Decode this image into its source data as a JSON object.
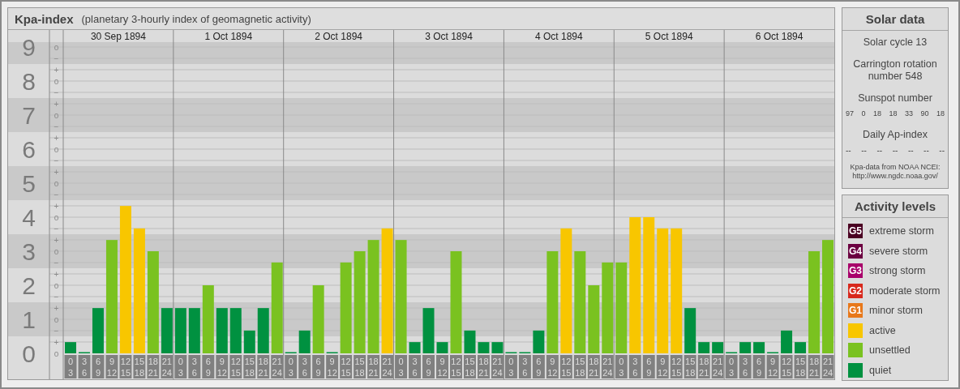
{
  "main_panel": {
    "title": "Kpa-index",
    "subtitle": "(planetary 3-hourly index of geomagnetic activity)"
  },
  "kp_chart": {
    "day_labels": [
      "30 Sep 1894",
      "1 Oct 1894",
      "2 Oct 1894",
      "3 Oct 1894",
      "4 Oct 1894",
      "5 Oct 1894",
      "6 Oct 1894"
    ],
    "sublevel_labels": [
      "o",
      "−",
      "+",
      "o",
      "−",
      "+",
      "o",
      "−",
      "+",
      "o",
      "−",
      "+",
      "o",
      "−",
      "+",
      "o",
      "−",
      "+",
      "o",
      "−",
      "+",
      "o",
      "−",
      "+",
      "o",
      "−",
      "+",
      "o"
    ],
    "chart_data": {
      "type": "bar",
      "grid": true,
      "ylim": [
        0,
        9.5
      ],
      "yticks": [
        {
          "value": 0,
          "label": "0"
        },
        {
          "value": 1,
          "label": "1"
        },
        {
          "value": 2,
          "label": "2"
        },
        {
          "value": 3,
          "label": "3"
        },
        {
          "value": 4,
          "label": "4"
        },
        {
          "value": 5,
          "label": "5"
        },
        {
          "value": 6,
          "label": "6"
        },
        {
          "value": 7,
          "label": "7"
        },
        {
          "value": 8,
          "label": "8"
        },
        {
          "value": 9,
          "label": "9"
        }
      ],
      "categories": [
        "0\n3",
        "3\n6",
        "6\n9",
        "9\n12",
        "12\n15",
        "15\n18",
        "18\n21",
        "21\n24",
        "0\n3",
        "3\n6",
        "6\n9",
        "9\n12",
        "12\n15",
        "15\n18",
        "18\n21",
        "21\n24",
        "0\n3",
        "3\n6",
        "6\n9",
        "9\n12",
        "12\n15",
        "15\n18",
        "18\n21",
        "21\n24",
        "0\n3",
        "3\n6",
        "6\n9",
        "9\n12",
        "12\n15",
        "15\n18",
        "18\n21",
        "21\n24",
        "0\n3",
        "3\n6",
        "6\n9",
        "9\n12",
        "12\n15",
        "15\n18",
        "18\n21",
        "21\n24",
        "0\n3",
        "3\n6",
        "6\n9",
        "9\n12",
        "12\n15",
        "15\n18",
        "18\n21",
        "21\n24",
        "0\n3",
        "3\n6",
        "6\n9",
        "9\n12",
        "12\n15",
        "15\n18",
        "18\n21",
        "21\n24"
      ],
      "series": [
        {
          "color": "#009140",
          "values": [
            0.33,
            0,
            1.33,
            null,
            null,
            null,
            null,
            1.33,
            1.33,
            1.33,
            null,
            1.33,
            1.33,
            0.67,
            1.33,
            null,
            0,
            0.67,
            null,
            0,
            null,
            null,
            null,
            null,
            null,
            0.33,
            1.33,
            0.33,
            null,
            0.67,
            0.33,
            0.33,
            0,
            0,
            0.67,
            null,
            null,
            null,
            null,
            null,
            null,
            null,
            null,
            null,
            null,
            1.33,
            0.33,
            0.33,
            0,
            0.33,
            0.33,
            0,
            0.67,
            0.33,
            null,
            null
          ]
        },
        {
          "color": "#7ac220",
          "values": [
            null,
            null,
            null,
            3.33,
            null,
            null,
            3,
            null,
            null,
            null,
            2,
            null,
            null,
            null,
            null,
            2.67,
            null,
            null,
            2,
            null,
            2.67,
            3,
            3.33,
            null,
            3.33,
            null,
            null,
            null,
            3,
            null,
            null,
            null,
            null,
            null,
            null,
            3,
            null,
            3,
            2,
            2.67,
            2.67,
            null,
            null,
            null,
            null,
            null,
            null,
            null,
            null,
            null,
            null,
            null,
            null,
            null,
            3,
            3.33
          ]
        },
        {
          "color": "#f8c600",
          "values": [
            null,
            null,
            null,
            null,
            4.33,
            3.67,
            null,
            null,
            null,
            null,
            null,
            null,
            null,
            null,
            null,
            null,
            null,
            null,
            null,
            null,
            null,
            null,
            null,
            3.67,
            null,
            null,
            null,
            null,
            null,
            null,
            null,
            null,
            null,
            null,
            null,
            null,
            3.67,
            null,
            null,
            null,
            null,
            4,
            4,
            3.67,
            3.67,
            null,
            null,
            null,
            null,
            null,
            null,
            null,
            null,
            null,
            null,
            null
          ]
        }
      ]
    }
  },
  "solar_data": {
    "title": "Solar data",
    "solar_cycle": "Solar cycle 13",
    "carrington": "Carrington rotation number 548",
    "sunspot_title": "Sunspot number",
    "sunspot_values": [
      "97",
      "0",
      "18",
      "18",
      "33",
      "90",
      "18"
    ],
    "ap_title": "Daily Ap-index",
    "ap_values": [
      "--",
      "--",
      "--",
      "--",
      "--",
      "--",
      "--"
    ],
    "source": "Kpa-data from NOAA NCEI: http://www.ngdc.noaa.gov/"
  },
  "activity_levels": {
    "title": "Activity levels",
    "items": [
      {
        "badge": "G5",
        "label": "extreme storm",
        "color": "#4a0022"
      },
      {
        "badge": "G4",
        "label": "severe storm",
        "color": "#6b0040"
      },
      {
        "badge": "G3",
        "label": "strong storm",
        "color": "#a8006a"
      },
      {
        "badge": "G2",
        "label": "moderate storm",
        "color": "#d8281c"
      },
      {
        "badge": "G1",
        "label": "minor storm",
        "color": "#e8781a"
      },
      {
        "label": "active",
        "color": "#f8c600"
      },
      {
        "label": "unsettled",
        "color": "#7ac220"
      },
      {
        "label": "quiet",
        "color": "#009140"
      }
    ]
  }
}
